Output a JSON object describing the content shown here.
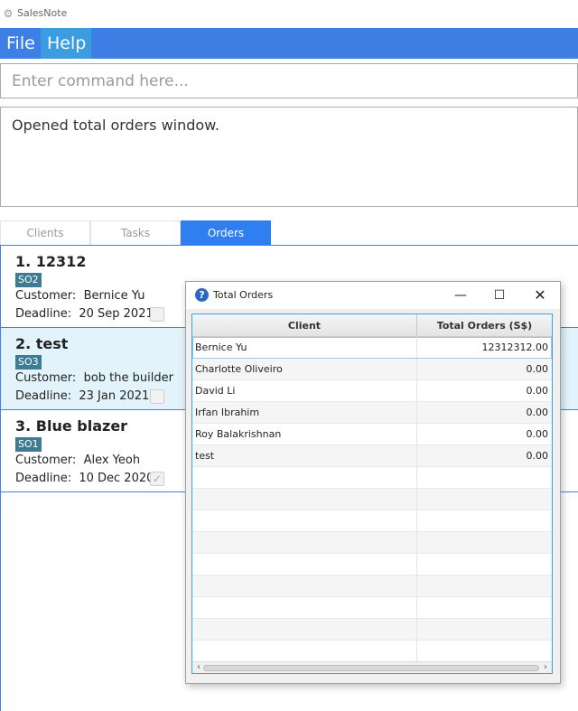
{
  "window": {
    "title": "SalesNote",
    "icon": "gear-icon"
  },
  "menu": {
    "file": "File",
    "help": "Help"
  },
  "command": {
    "placeholder": "Enter command here...",
    "value": ""
  },
  "result": {
    "text": "Opened total orders window."
  },
  "tabs": [
    {
      "label": "Clients",
      "active": false
    },
    {
      "label": "Tasks",
      "active": false
    },
    {
      "label": "Orders",
      "active": true
    }
  ],
  "orders": [
    {
      "title": "1. 12312",
      "tag": "SO2",
      "customer_label": "Customer:",
      "customer": "Bernice Yu",
      "deadline_label": "Deadline:",
      "deadline": "20 Sep 2021",
      "done": false
    },
    {
      "title": "2. test",
      "tag": "SO3",
      "customer_label": "Customer:",
      "customer": "bob the builder",
      "deadline_label": "Deadline:",
      "deadline": "23 Jan 2021",
      "done": false
    },
    {
      "title": "3. Blue blazer",
      "tag": "SO1",
      "customer_label": "Customer:",
      "customer": "Alex Yeoh",
      "deadline_label": "Deadline:",
      "deadline": "10 Dec 2020",
      "done": true
    }
  ],
  "dialog": {
    "title": "Total Orders",
    "icon": "question-icon",
    "columns": [
      "Client",
      "Total Orders (S$)"
    ],
    "rows": [
      {
        "client": "Bernice Yu",
        "total": "12312312.00"
      },
      {
        "client": "Charlotte Oliveiro",
        "total": "0.00"
      },
      {
        "client": "David Li",
        "total": "0.00"
      },
      {
        "client": "Irfan Ibrahim",
        "total": "0.00"
      },
      {
        "client": "Roy Balakrishnan",
        "total": "0.00"
      },
      {
        "client": "test",
        "total": "0.00"
      }
    ],
    "empty_rows": 9
  },
  "colors": {
    "menu_bar": "#3e7fe6",
    "menu_help_active": "#3b9de0",
    "tab_active": "#2f7ff0",
    "selected_card": "#e2f3fb",
    "tag_bg": "#3e7b94",
    "table_border": "#3c9ee6"
  }
}
